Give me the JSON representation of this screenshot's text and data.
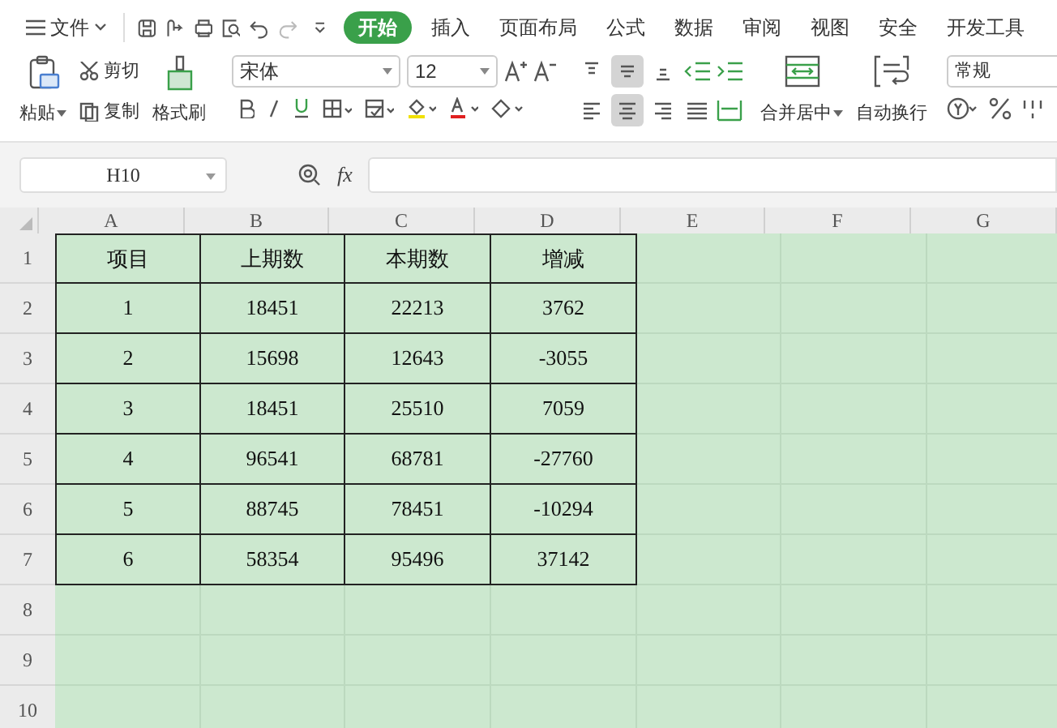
{
  "menu": {
    "file_label": "文件",
    "tabs": [
      {
        "label": "开始",
        "selected": true
      },
      {
        "label": "插入",
        "selected": false
      },
      {
        "label": "页面布局",
        "selected": false
      },
      {
        "label": "公式",
        "selected": false
      },
      {
        "label": "数据",
        "selected": false
      },
      {
        "label": "审阅",
        "selected": false
      },
      {
        "label": "视图",
        "selected": false
      },
      {
        "label": "安全",
        "selected": false
      },
      {
        "label": "开发工具",
        "selected": false
      }
    ]
  },
  "ribbon": {
    "paste": "粘贴",
    "cut": "剪切",
    "copy": "复制",
    "format_painter": "格式刷",
    "font_name": "宋体",
    "font_size": "12",
    "vertical_align": [
      {
        "selected": false
      },
      {
        "selected": true
      },
      {
        "selected": false
      }
    ],
    "horizontal_align": [
      {
        "selected": false
      },
      {
        "selected": true
      },
      {
        "selected": false
      }
    ],
    "merge": "合并居中",
    "wrap": "自动换行",
    "number_format": "常规"
  },
  "formula_bar": {
    "name_box": "H10",
    "fx": "fx"
  },
  "sheet": {
    "columns": [
      "A",
      "B",
      "C",
      "D",
      "E",
      "F",
      "G"
    ],
    "rows": [
      {
        "label": "1",
        "cells": [
          "项目",
          "上期数",
          "本期数",
          "增减"
        ]
      },
      {
        "label": "2",
        "cells": [
          "1",
          "18451",
          "22213",
          "3762"
        ]
      },
      {
        "label": "3",
        "cells": [
          "2",
          "15698",
          "12643",
          "-3055"
        ]
      },
      {
        "label": "4",
        "cells": [
          "3",
          "18451",
          "25510",
          "7059"
        ]
      },
      {
        "label": "5",
        "cells": [
          "4",
          "96541",
          "68781",
          "-27760"
        ]
      },
      {
        "label": "6",
        "cells": [
          "5",
          "88745",
          "78451",
          "-10294"
        ]
      },
      {
        "label": "7",
        "cells": [
          "6",
          "58354",
          "95496",
          "37142"
        ]
      },
      {
        "label": "8",
        "cells": []
      },
      {
        "label": "9",
        "cells": []
      },
      {
        "label": "10",
        "cells": []
      }
    ]
  }
}
